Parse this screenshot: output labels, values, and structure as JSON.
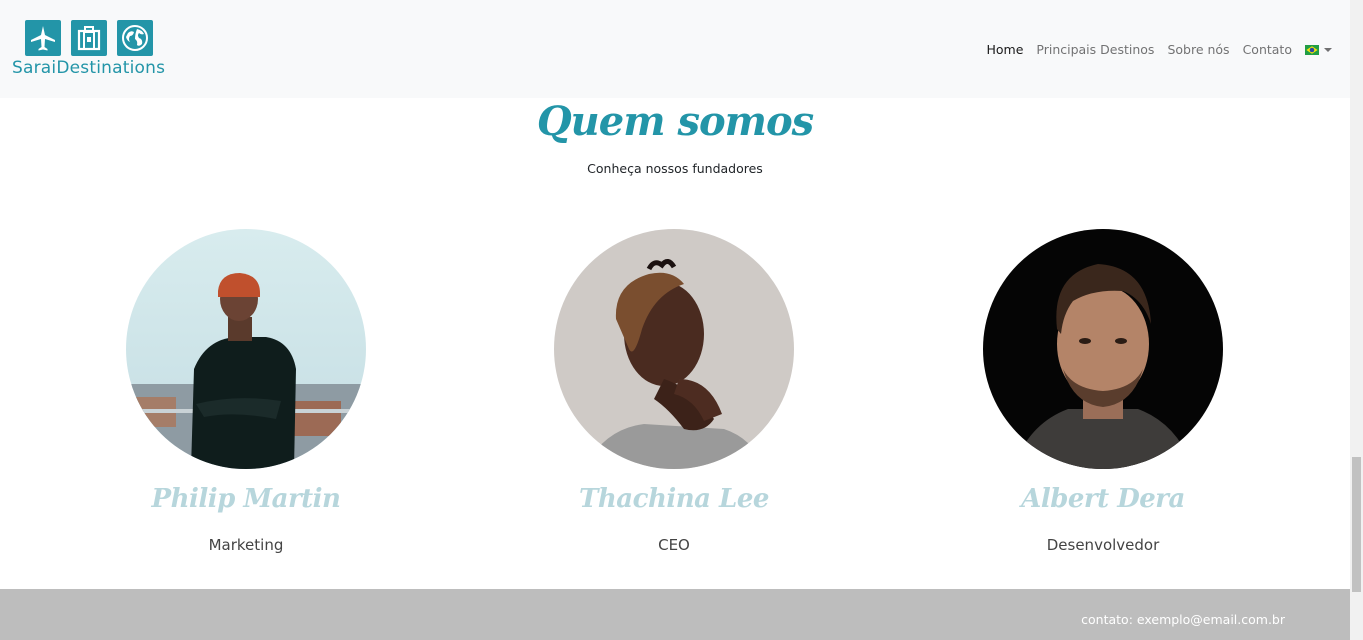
{
  "brand": {
    "name": "SaraiDestinations",
    "color": "#2395a8",
    "icons": [
      "airplane-icon",
      "suitcase-icon",
      "globe-icon"
    ]
  },
  "nav": {
    "items": [
      {
        "label": "Home",
        "active": true
      },
      {
        "label": "Principais Destinos",
        "active": false
      },
      {
        "label": "Sobre nós",
        "active": false
      },
      {
        "label": "Contato",
        "active": false
      }
    ],
    "language_icon": "brazil-flag-icon"
  },
  "section": {
    "title": "Quem somos",
    "subtitle": "Conheça nossos fundadores"
  },
  "team": [
    {
      "name": "Philip Martin",
      "role": "Marketing"
    },
    {
      "name": "Thachina Lee",
      "role": "CEO"
    },
    {
      "name": "Albert Dera",
      "role": "Desenvolvedor"
    }
  ],
  "footer": {
    "contact": "contato: exemplo@email.com.br"
  }
}
